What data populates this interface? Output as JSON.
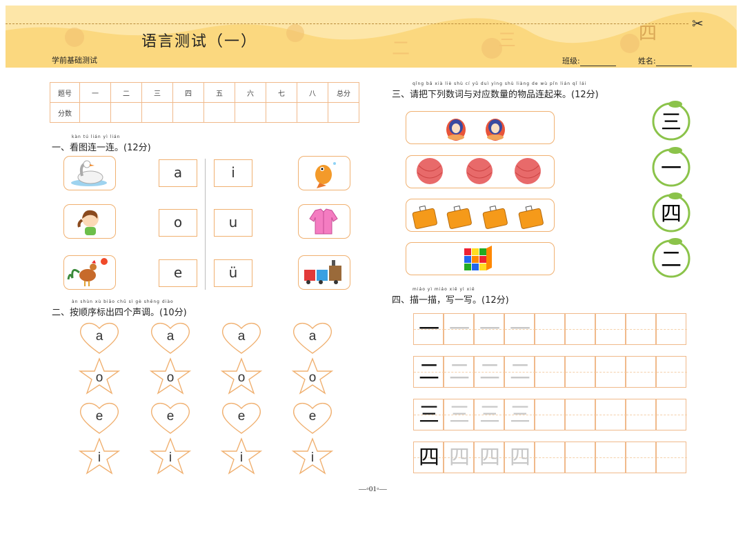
{
  "header": {
    "title": "语言测试（一）",
    "subtitle": "学前基础测试",
    "class_label": "班级:",
    "name_label": "姓名:",
    "bg_numerals": [
      "二",
      "三",
      "四"
    ]
  },
  "score_table": {
    "row1": [
      "题号",
      "一",
      "二",
      "三",
      "四",
      "五",
      "六",
      "七",
      "八",
      "总分"
    ],
    "row2_label": "分数"
  },
  "section1": {
    "pinyin": "kàn  tú  lián  yì  lián",
    "heading": "一、看图连一连。(12分)",
    "letters_left": [
      "a",
      "o",
      "e"
    ],
    "letters_right": [
      "i",
      "u",
      "ü"
    ]
  },
  "section2": {
    "pinyin": "àn  shùn  xù  biāo  chū  sì  gè  shēng diào",
    "heading": "二、按顺序标出四个声调。(10分)",
    "rows": [
      {
        "shape": "heart",
        "letter": "a"
      },
      {
        "shape": "star",
        "letter": "o"
      },
      {
        "shape": "heart",
        "letter": "e"
      },
      {
        "shape": "star",
        "letter": "i"
      }
    ]
  },
  "section3": {
    "pinyin": "qǐng  bǎ  xià  liè  shù  cí  yǔ  duì  yìng shù liàng de  wù  pǐn  lián  qǐ  lái",
    "heading": "三、请把下列数词与对应数量的物品连起来。(12分)",
    "numerals": [
      "三",
      "一",
      "四",
      "二"
    ]
  },
  "section4": {
    "pinyin": "miáo  yì  miáo      xiě  yì  xiě",
    "heading": "四、描一描，写一写。(12分)",
    "chars": [
      "一",
      "二",
      "三",
      "四"
    ]
  },
  "footer": {
    "page": "—◦01◦—"
  }
}
